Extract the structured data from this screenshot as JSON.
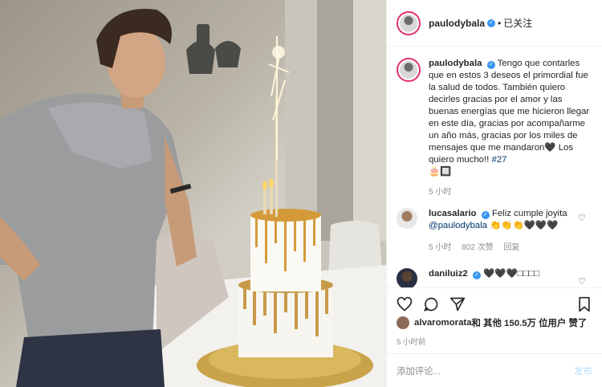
{
  "post": {
    "username": "paulodybala",
    "follow_label": "已关注",
    "caption_user": "paulodybala",
    "caption_text": "Tengo que contarles que en estos 3 deseos el primordial fue la salud de todos. También quiero decirles gracias por el amor y las buenas energías que me hicieron llegar en este día, gracias por acompañarme un año más, gracias por los miles de mensajes que me mandaron🖤 Los quiero mucho!! ",
    "caption_tag": "#27",
    "caption_extra": "🎂🔲",
    "caption_time": "5 小时"
  },
  "comments": [
    {
      "username": "lucasalario",
      "text": "Feliz cumple joyita ",
      "mention": "@paulodybala",
      "emojis": " 👏👏👏🖤🖤🖤",
      "time": "5 小时",
      "likes": "802 次赞",
      "reply": "回复"
    },
    {
      "username": "daniluiz2",
      "text": "🖤🖤🖤□□□□"
    }
  ],
  "likes_line": {
    "user": "alvaromorata",
    "rest": " 和 其他 150.5万 位用户 赞了"
  },
  "post_time": "5 小时前",
  "add_comment": {
    "placeholder": "添加评论...",
    "post_label": "发布"
  },
  "icons": [
    "heart-icon",
    "comment-icon",
    "share-icon",
    "bookmark-icon",
    "verified-icon"
  ],
  "colors": {
    "verified": "#3897f0",
    "link": "#00376b",
    "muted": "#8e8e8e",
    "post_button": "#b2dffc",
    "story_ring": "#e1306c"
  }
}
